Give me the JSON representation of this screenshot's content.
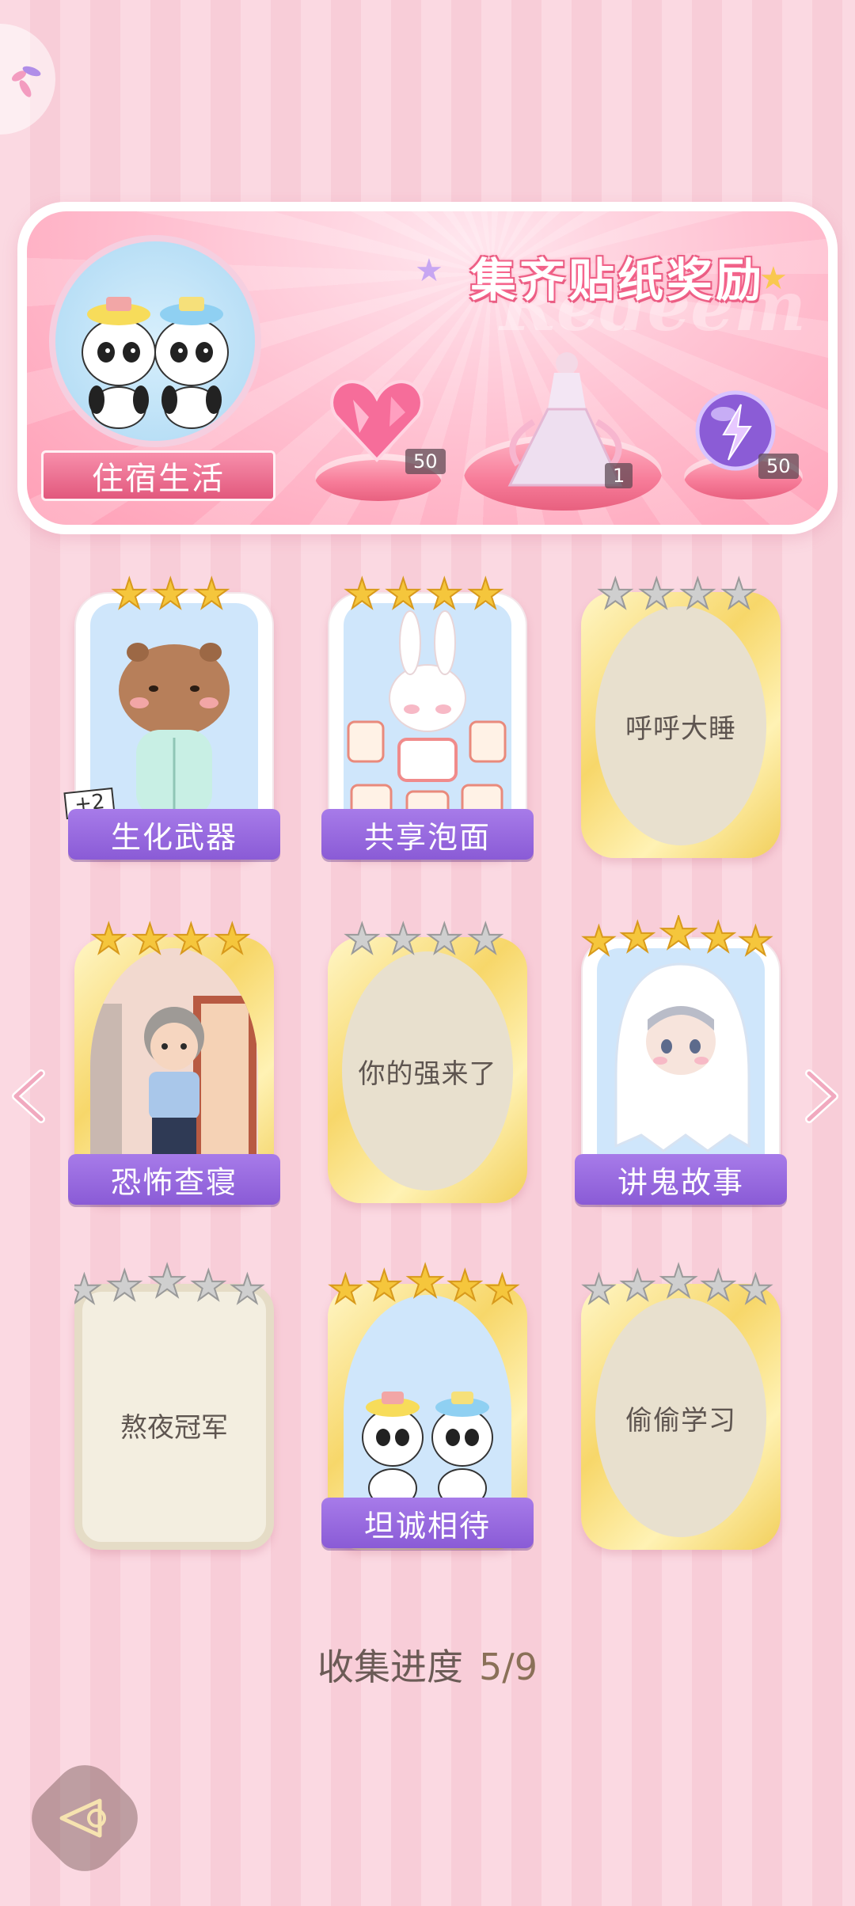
{
  "banner": {
    "title": "集齐贴纸奖励",
    "watermark": "Redeem",
    "theme_label": "住宿生活",
    "rewards": [
      {
        "icon": "heart-gem-icon",
        "count": "50"
      },
      {
        "icon": "gown-outfit-icon",
        "count": "1"
      },
      {
        "icon": "energy-orb-icon",
        "count": "50"
      }
    ]
  },
  "cards": [
    {
      "label": "生化武器",
      "collected": true,
      "stars": 3,
      "badge": "+2"
    },
    {
      "label": "共享泡面",
      "collected": true,
      "stars": 4
    },
    {
      "label": "呼呼大睡",
      "collected": false,
      "stars": 4
    },
    {
      "label": "恐怖查寝",
      "collected": true,
      "stars": 4
    },
    {
      "label": "你的强来了",
      "collected": false,
      "stars": 4
    },
    {
      "label": "讲鬼故事",
      "collected": true,
      "stars": 5
    },
    {
      "label": "熬夜冠军",
      "collected": false,
      "stars": 5
    },
    {
      "label": "坦诚相待",
      "collected": true,
      "stars": 5
    },
    {
      "label": "偷偷学习",
      "collected": false,
      "stars": 5
    }
  ],
  "progress": {
    "label": "收集进度",
    "value": "5/9"
  },
  "colors": {
    "gold_star": "#f5c63c",
    "grey_star": "#bfbfbf",
    "label_purple": "#9466dc",
    "accent_pink": "#e6587e"
  }
}
